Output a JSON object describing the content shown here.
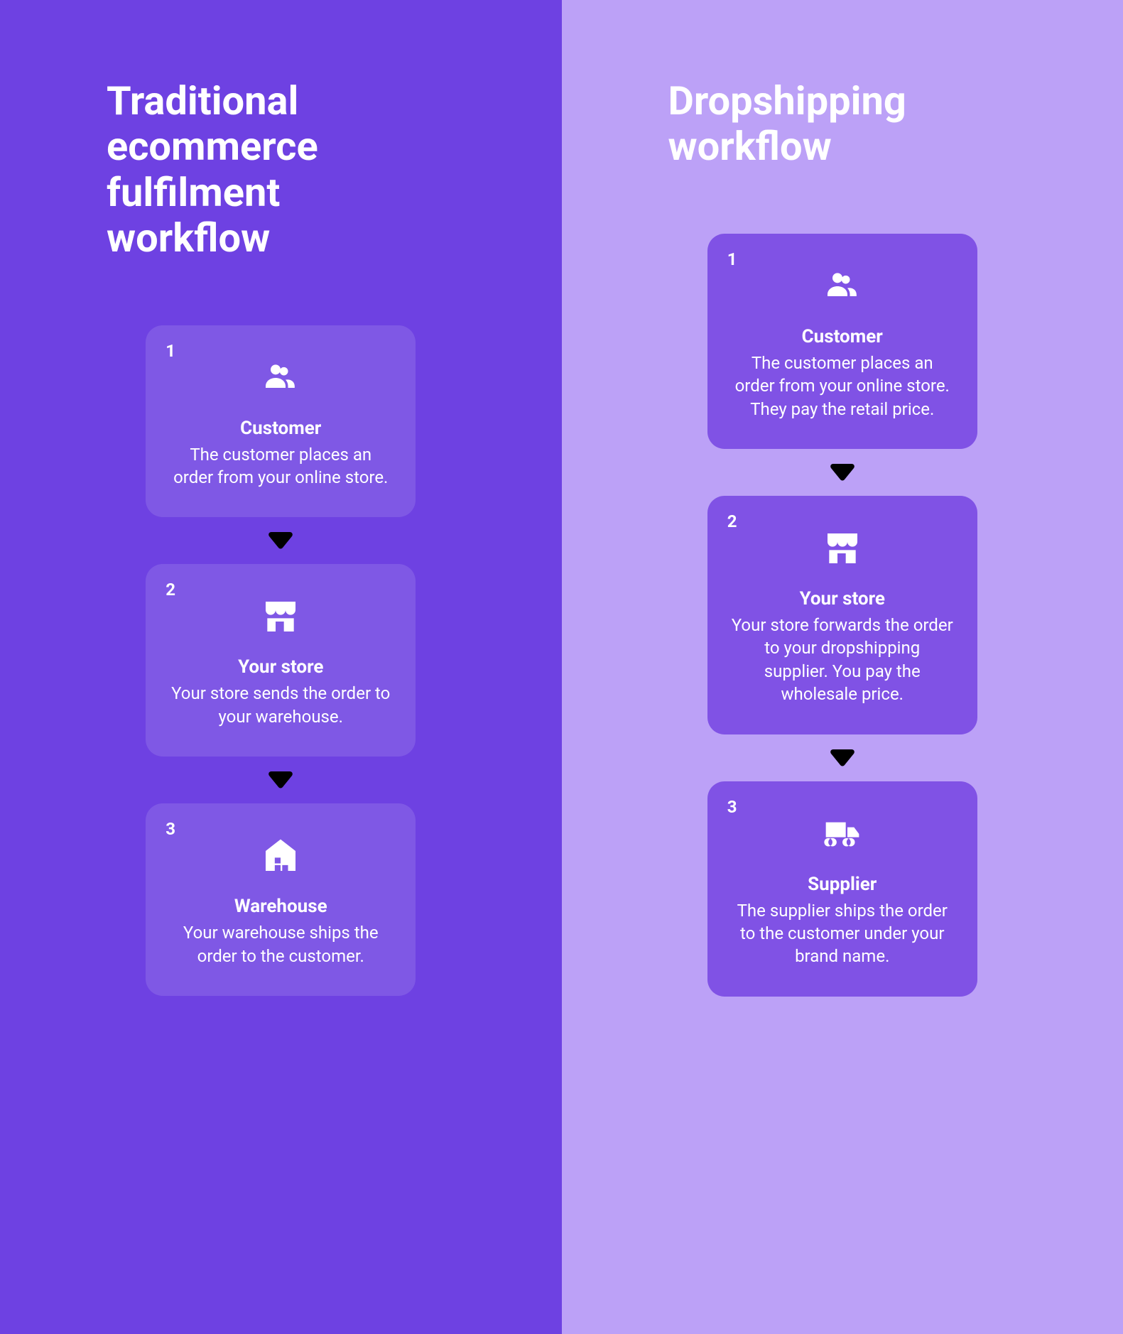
{
  "left": {
    "title": "Traditional\necommerce\nfulfilment\nworkflow",
    "steps": [
      {
        "num": "1",
        "icon": "users-icon",
        "title": "Customer",
        "desc": "The customer places an order from your online store."
      },
      {
        "num": "2",
        "icon": "store-icon",
        "title": "Your store",
        "desc": "Your store sends the order to your warehouse."
      },
      {
        "num": "3",
        "icon": "warehouse-icon",
        "title": "Warehouse",
        "desc": "Your warehouse ships the order to the customer."
      }
    ]
  },
  "right": {
    "title": "Dropshipping\nworkflow",
    "steps": [
      {
        "num": "1",
        "icon": "users-icon",
        "title": "Customer",
        "desc": "The customer places an order from your online store. They pay the retail price."
      },
      {
        "num": "2",
        "icon": "store-icon",
        "title": "Your store",
        "desc": "Your store forwards the order to your dropshipping supplier. You pay the wholesale price."
      },
      {
        "num": "3",
        "icon": "truck-icon",
        "title": "Supplier",
        "desc": "The supplier ships the order to the customer under your brand name."
      }
    ]
  }
}
